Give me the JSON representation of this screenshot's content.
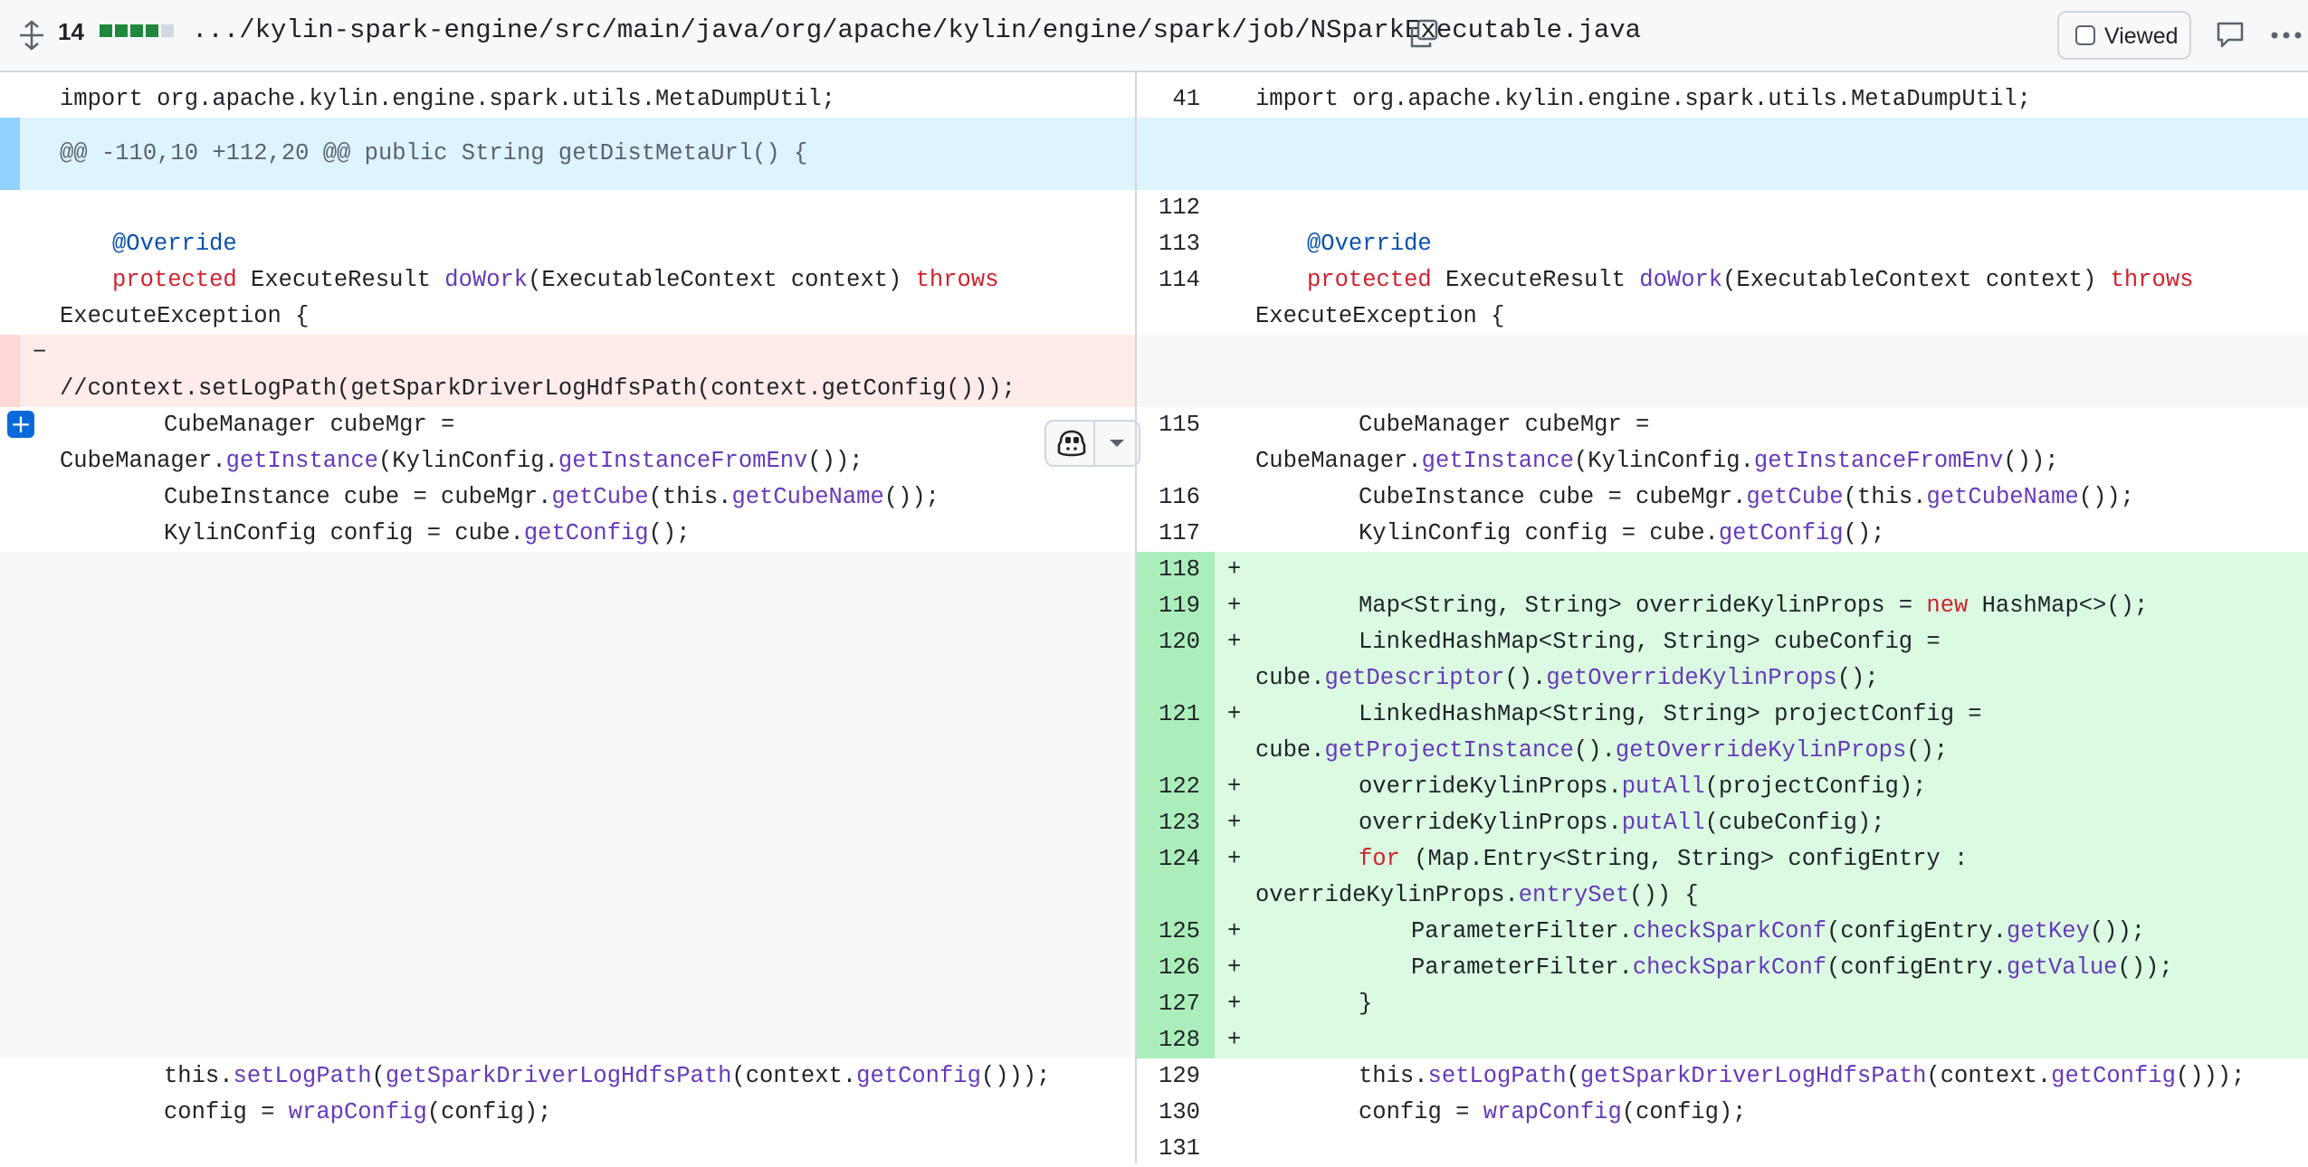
{
  "file_header": {
    "changes_count": "14",
    "file_path": ".../kylin-spark-engine/src/main/java/org/apache/kylin/engine/spark/job/NSparkExecutable.java",
    "viewed_label": "Viewed",
    "icons": [
      "expand-icon",
      "copy-icon",
      "comment-icon",
      "kebab-icon"
    ]
  },
  "hunk_header": "@@ -110,10 +112,20 @@ public String getDistMetaUrl() {",
  "left": {
    "import_line": "import org.apache.kylin.engine.spark.utils.MetaDumpUtil;",
    "override": "@Override",
    "dowork_kw": "protected",
    "dowork_type": "ExecuteResult",
    "dowork_fn": "doWork",
    "dowork_args": "(ExecutableContext context)",
    "dowork_throws": "throws",
    "dowork_exc": "ExecuteException {",
    "deleted_marker": "−",
    "deleted_line": "//context.setLogPath(getSparkDriverLogHdfsPath(context.getConfig()));",
    "cubemgr_1": "CubeManager cubeMgr =",
    "cubemgr_2a": "CubeManager.",
    "cubemgr_2b": "getInstance",
    "cubemgr_2c": "(KylinConfig.",
    "cubemgr_2d": "getInstanceFromEnv",
    "cubemgr_2e": "());",
    "cube_a": "CubeInstance cube = cubeMgr.",
    "cube_b": "getCube",
    "cube_c": "(this.",
    "cube_d": "getCubeName",
    "cube_e": "());",
    "config_a": "KylinConfig config = cube.",
    "config_b": "getConfig",
    "config_c": "();",
    "setlog_a": "this.",
    "setlog_b": "setLogPath",
    "setlog_c": "(",
    "setlog_d": "getSparkDriverLogHdfsPath",
    "setlog_e": "(context.",
    "setlog_f": "getConfig",
    "setlog_g": "()));",
    "wrap_a": "config = ",
    "wrap_b": "wrapConfig",
    "wrap_c": "(config);"
  },
  "right": {
    "nums": {
      "n41": "41",
      "n112": "112",
      "n113": "113",
      "n114": "114",
      "n115": "115",
      "n116": "116",
      "n117": "117",
      "n118": "118",
      "n119": "119",
      "n120": "120",
      "n121": "121",
      "n122": "122",
      "n123": "123",
      "n124": "124",
      "n125": "125",
      "n126": "126",
      "n127": "127",
      "n128": "128",
      "n129": "129",
      "n130": "130",
      "n131": "131"
    },
    "add_marker": "+",
    "map_a": "Map<String, String> overrideKylinProps = ",
    "map_b": "new",
    "map_c": " HashMap<>();",
    "cubecfg_1": "LinkedHashMap<String, String> cubeConfig =",
    "cubecfg_2a": "cube.",
    "cubecfg_2b": "getDescriptor",
    "cubecfg_2c": "().",
    "cubecfg_2d": "getOverrideKylinProps",
    "cubecfg_2e": "();",
    "projcfg_1": "LinkedHashMap<String, String> projectConfig =",
    "projcfg_2a": "cube.",
    "projcfg_2b": "getProjectInstance",
    "projcfg_2c": "().",
    "projcfg_2d": "getOverrideKylinProps",
    "projcfg_2e": "();",
    "put1_a": "overrideKylinProps.",
    "put1_b": "putAll",
    "put1_c": "(projectConfig);",
    "put2_a": "overrideKylinProps.",
    "put2_b": "putAll",
    "put2_c": "(cubeConfig);",
    "for_a": "for",
    "for_b": " (Map.Entry<String, String> configEntry :",
    "for_2a": "overrideKylinProps.",
    "for_2b": "entrySet",
    "for_2c": "()) {",
    "chk1_a": "ParameterFilter.",
    "chk1_b": "checkSparkConf",
    "chk1_c": "(configEntry.",
    "chk1_d": "getKey",
    "chk1_e": "());",
    "chk2_a": "ParameterFilter.",
    "chk2_b": "checkSparkConf",
    "chk2_c": "(configEntry.",
    "chk2_d": "getValue",
    "chk2_e": "());",
    "close_brace": "}"
  },
  "colors": {
    "hunk_bg": "#ddf4ff",
    "del_bg": "#ffebe9",
    "del_num_bg": "#ffd7d5",
    "add_bg": "#dafbe1",
    "add_num_bg": "#aceebb",
    "empty_bg": "#f6f8fa"
  }
}
